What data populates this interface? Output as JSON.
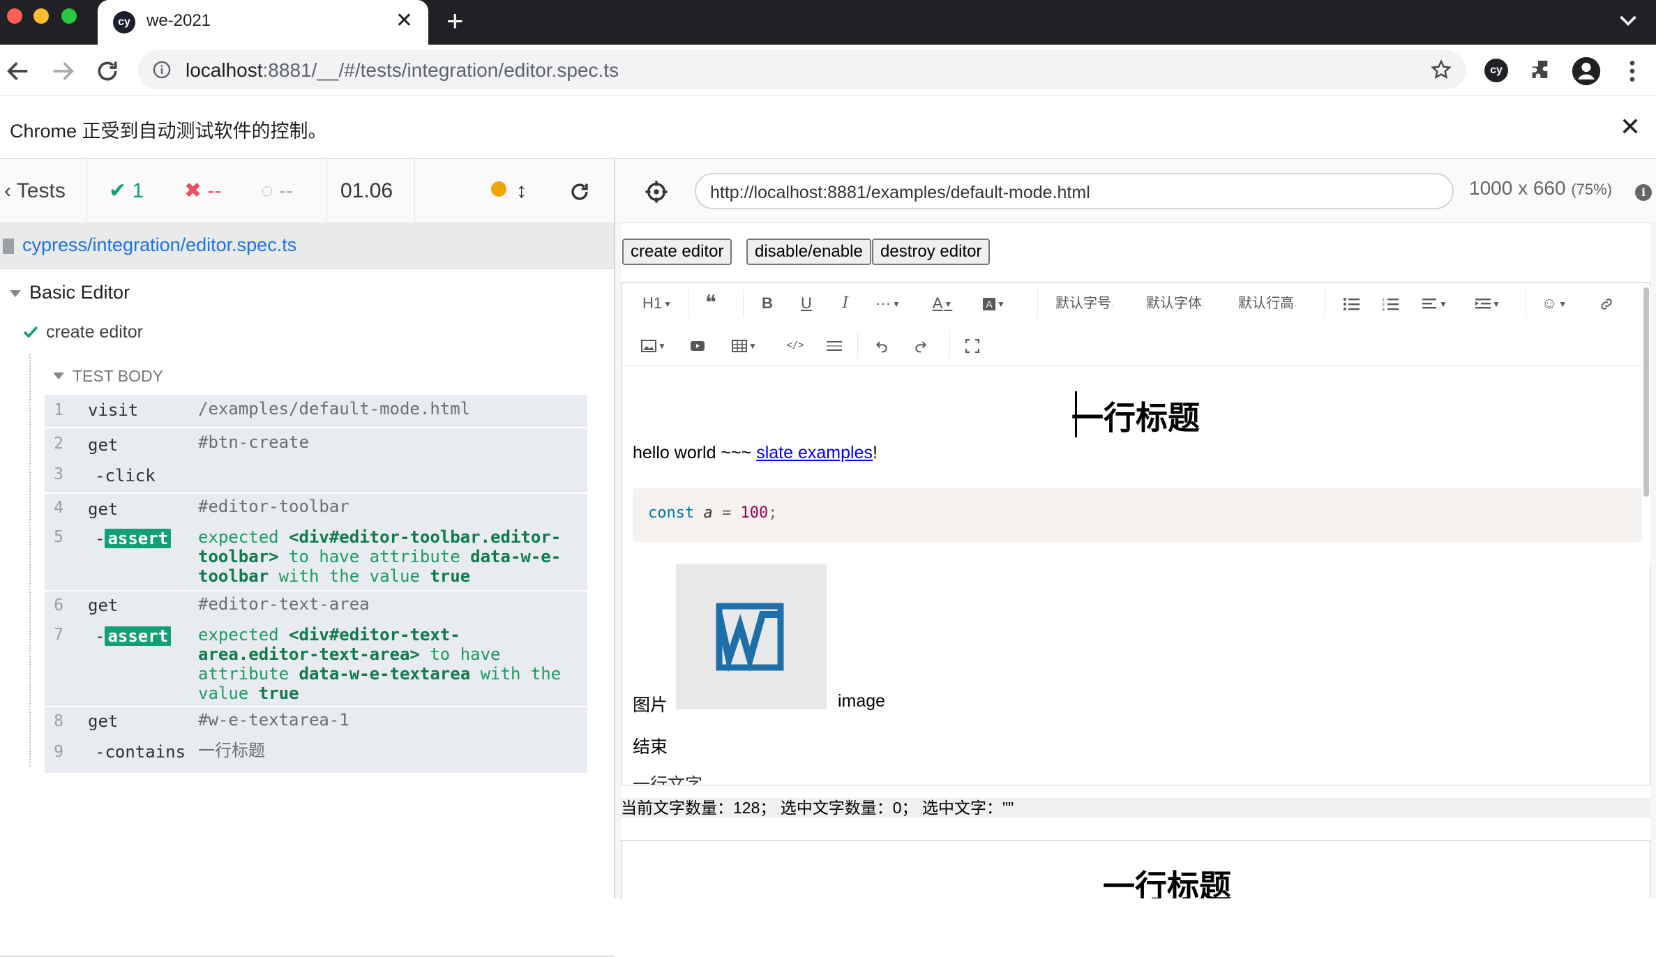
{
  "browser": {
    "tab_title": "we-2021",
    "tab_favicon": "cy",
    "url_host": "localhost",
    "url_rest": ":8881/__/#/tests/integration/editor.spec.ts",
    "infobar_text": "Chrome 正受到自动测试软件的控制。",
    "profile_favicon": "cy"
  },
  "reporter": {
    "back_label": "Tests",
    "passed": "1",
    "failed": "--",
    "pending": "--",
    "duration": "01.06",
    "spec_path": "cypress/integration/editor.spec.ts",
    "suite_title": "Basic Editor",
    "test_title": "create editor",
    "test_body_label": "TEST BODY",
    "commands": [
      {
        "num": "1",
        "name": "visit",
        "msg": "/examples/default-mode.html"
      },
      {
        "num": "2",
        "name": "get",
        "msg": "#btn-create"
      },
      {
        "num": "3",
        "name": "-click",
        "msg": ""
      },
      {
        "num": "4",
        "name": "get",
        "msg": "#editor-toolbar"
      },
      {
        "num": "5",
        "name": "assert",
        "msg_parts": [
          "expected",
          "<div#editor-toolbar.editor-toolbar>",
          "to have attribute",
          "data-w-e-toolbar",
          "with the value",
          "true"
        ]
      },
      {
        "num": "6",
        "name": "get",
        "msg": "#editor-text-area"
      },
      {
        "num": "7",
        "name": "assert",
        "msg_parts": [
          "expected",
          "<div#editor-text-area.editor-text-area>",
          "to have attribute",
          "data-w-e-textarea",
          "with the",
          "value",
          "true"
        ]
      },
      {
        "num": "8",
        "name": "get",
        "msg": "#w-e-textarea-1"
      },
      {
        "num": "9",
        "name": "-contains",
        "msg": "一行标题"
      }
    ]
  },
  "aut": {
    "url": "http://localhost:8881/examples/default-mode.html",
    "viewport": "1000 x 660",
    "scale": "(75%)",
    "info_glyph": "i",
    "buttons": {
      "create": "create editor",
      "toggle": "disable/enable",
      "destroy": "destroy editor"
    },
    "toolbar": {
      "heading": "H1",
      "font_size": "默认字号",
      "font_family": "默认字体",
      "line_height": "默认行高"
    },
    "content": {
      "heading": "一行标题",
      "p1_text": "hello world ~~~ ",
      "p1_link": "slate examples",
      "p1_end": "!",
      "code_key": "const",
      "code_var": "a",
      "code_op": " = ",
      "code_num": "100",
      "code_end": ";",
      "img_label": "图片",
      "img_after": "image",
      "end_label": "结束",
      "cut_label": "一行文字"
    },
    "status": "当前文字数量：128；  选中文字数量：0；  选中文字：\"\"",
    "second_heading": "一行标题"
  }
}
